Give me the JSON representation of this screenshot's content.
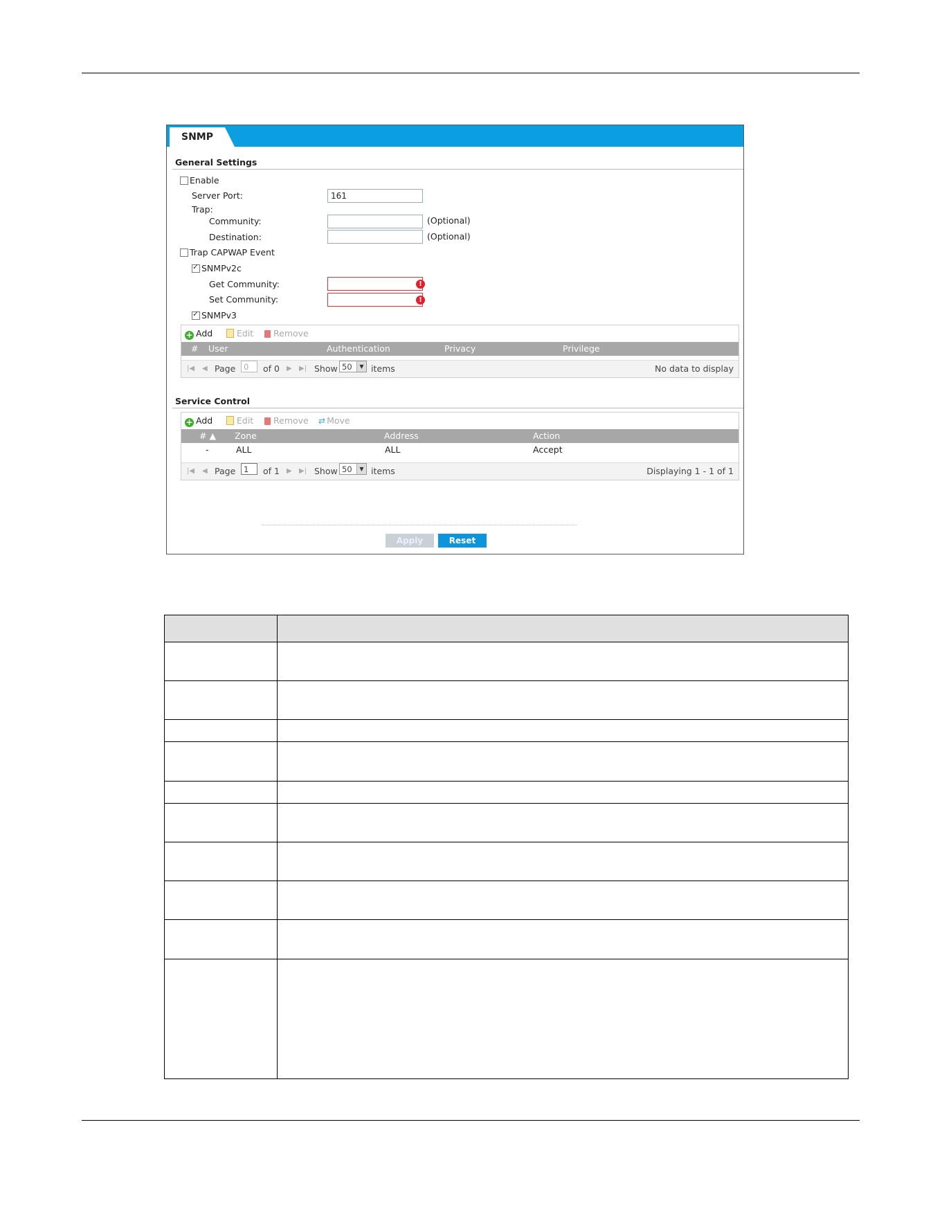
{
  "tab": {
    "label": "SNMP"
  },
  "general": {
    "title": "General Settings",
    "enable_label": "Enable",
    "server_port_label": "Server Port:",
    "server_port_value": "161",
    "trap_label": "Trap:",
    "community_label": "Community:",
    "community_value": "",
    "destination_label": "Destination:",
    "destination_value": "",
    "optional_text": "(Optional)",
    "trap_capwap_label": "Trap CAPWAP Event",
    "snmpv2c_label": "SNMPv2c",
    "get_community_label": "Get Community:",
    "set_community_label": "Set Community:",
    "snmpv3_label": "SNMPv3",
    "enable_checked": false,
    "trap_capwap_checked": false,
    "snmpv2c_checked": true,
    "snmpv3_checked": true
  },
  "v3_grid": {
    "add": "Add",
    "edit": "Edit",
    "remove": "Remove",
    "columns": [
      "#",
      "User",
      "Authentication",
      "Privacy",
      "Privilege"
    ],
    "pager": {
      "page_label": "Page",
      "page_value": "0",
      "of_text": "of 0",
      "show_label": "Show",
      "show_value": "50",
      "items_label": "items",
      "status": "No data to display"
    }
  },
  "service": {
    "title": "Service Control",
    "add": "Add",
    "edit": "Edit",
    "remove": "Remove",
    "move": "Move",
    "columns": [
      "# ▲",
      "Zone",
      "Address",
      "Action"
    ],
    "rows": [
      {
        "num": "-",
        "zone": "ALL",
        "address": "ALL",
        "action": "Accept"
      }
    ],
    "pager": {
      "page_label": "Page",
      "page_value": "1",
      "of_text": "of 1",
      "show_label": "Show",
      "show_value": "50",
      "items_label": "items",
      "status": "Displaying 1 - 1 of 1"
    }
  },
  "buttons": {
    "apply": "Apply",
    "reset": "Reset"
  },
  "colors": {
    "accent": "#0b9ee0",
    "error": "#e0202a",
    "header_gray": "#a7a7a7"
  }
}
